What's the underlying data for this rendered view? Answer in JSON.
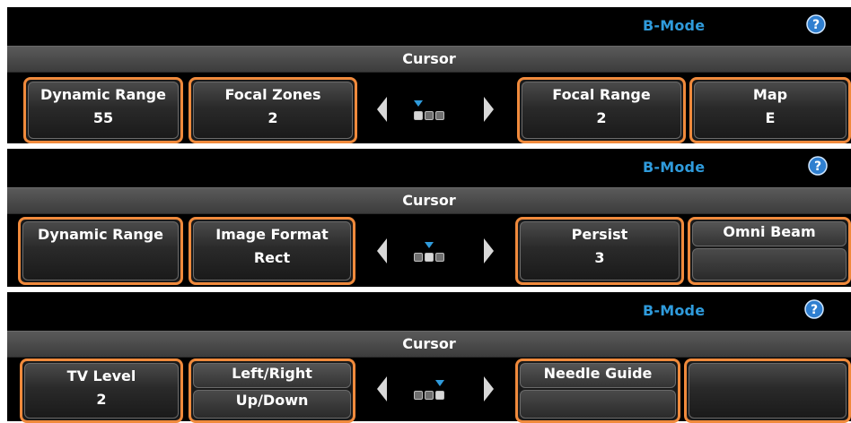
{
  "panels": [
    {
      "mode": "B-Mode",
      "cursor_label": "Cursor",
      "active_page": 1,
      "buttons": [
        {
          "label": "Dynamic Range",
          "value": "55"
        },
        {
          "label": "Focal Zones",
          "value": "2"
        },
        {
          "label": "Focal Range",
          "value": "2"
        },
        {
          "label": "Map",
          "value": "E"
        }
      ]
    },
    {
      "mode": "B-Mode",
      "cursor_label": "Cursor",
      "active_page": 2,
      "buttons": [
        {
          "label": "Dynamic Range",
          "value": ""
        },
        {
          "label": "Image Format",
          "value": "Rect"
        },
        {
          "label": "Persist",
          "value": "3"
        },
        {
          "label": "Omni Beam",
          "value": ""
        }
      ]
    },
    {
      "mode": "B-Mode",
      "cursor_label": "Cursor",
      "active_page": 3,
      "buttons": [
        {
          "label": "TV Level",
          "value": "2"
        },
        {
          "label": "Left/Right",
          "value": "Up/Down"
        },
        {
          "label": "Needle Guide",
          "value": ""
        },
        {
          "label": "",
          "value": ""
        }
      ]
    }
  ],
  "colors": {
    "accent_orange": "#f08a3c",
    "mode_blue": "#2f9bdc",
    "panel_black": "#000000"
  },
  "icons": {
    "help": "help-icon",
    "prev": "arrow-left-icon",
    "next": "arrow-right-icon"
  }
}
